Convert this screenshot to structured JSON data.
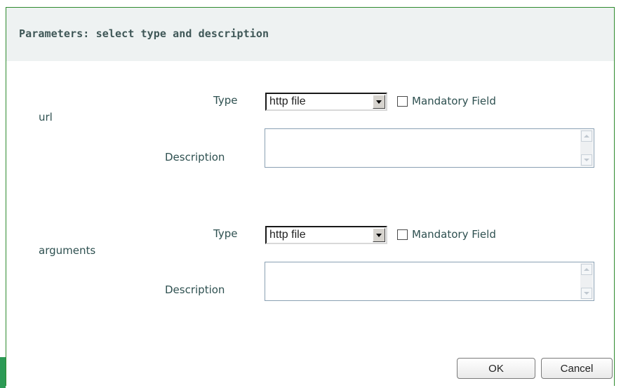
{
  "dialog": {
    "title": "Parameters: select type and description"
  },
  "params": [
    {
      "name": "url",
      "type_label": "Type",
      "type_value": "http file",
      "mandatory_label": "Mandatory Field",
      "mandatory_checked": false,
      "description_label": "Description",
      "description_value": ""
    },
    {
      "name": "arguments",
      "type_label": "Type",
      "type_value": "http file",
      "mandatory_label": "Mandatory Field",
      "mandatory_checked": false,
      "description_label": "Description",
      "description_value": ""
    }
  ],
  "buttons": {
    "ok_label": "OK",
    "cancel_label": "Cancel"
  },
  "colors": {
    "label_text": "#2e5050",
    "header_bg": "#eef2f2",
    "dialog_border": "#2e8a2e",
    "accent_strip": "#2c9a55"
  },
  "icons": {
    "dropdown": "chevron-down-icon",
    "scroll_up": "scroll-up-icon",
    "scroll_down": "scroll-down-icon"
  }
}
